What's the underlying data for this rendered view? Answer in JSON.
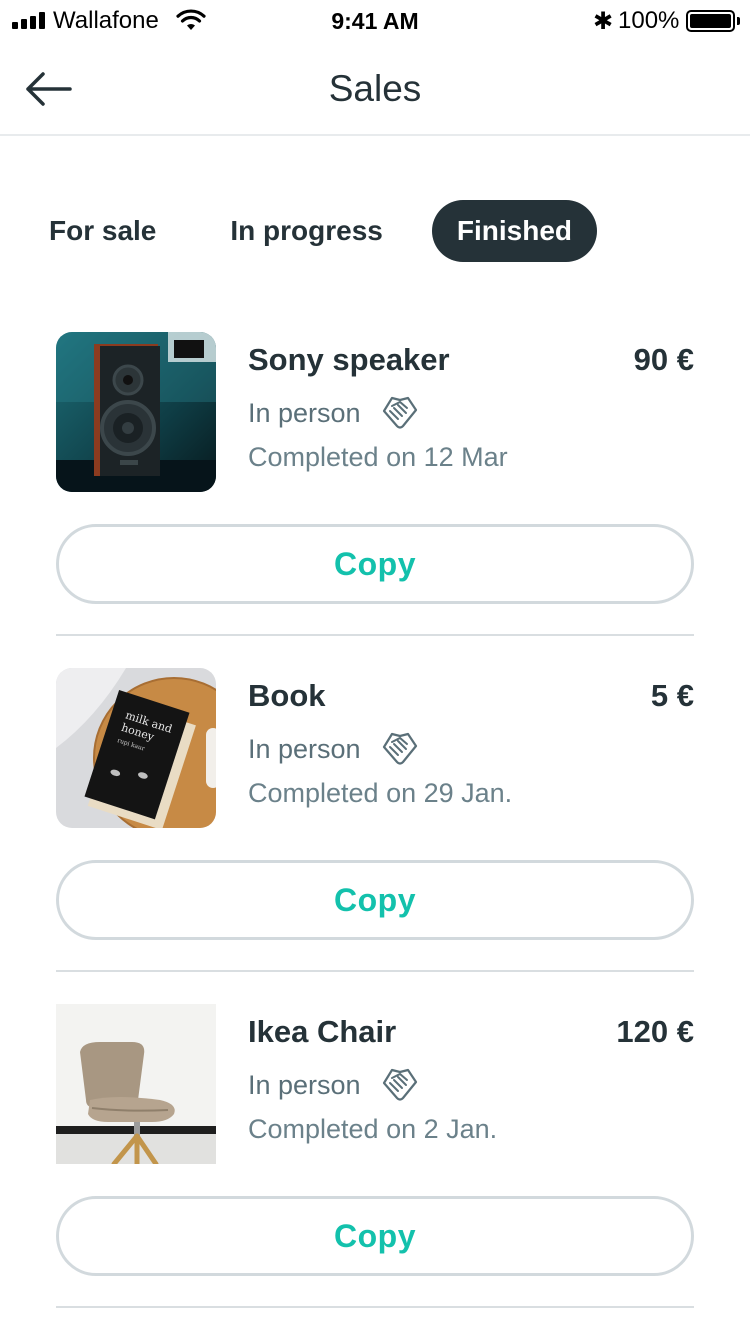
{
  "status_bar": {
    "carrier": "Wallafone",
    "time": "9:41 AM",
    "battery": "100%"
  },
  "header": {
    "title": "Sales",
    "back_icon": "arrow-left-icon"
  },
  "tabs": [
    {
      "label": "For sale",
      "active": false
    },
    {
      "label": "In progress",
      "active": false
    },
    {
      "label": "Finished",
      "active": true
    }
  ],
  "items": [
    {
      "title": "Sony speaker",
      "price": "90 €",
      "delivery": "In person",
      "completed": "Completed on 12 Mar",
      "copy_label": "Copy",
      "image": "speaker"
    },
    {
      "title": "Book",
      "price": "5 €",
      "delivery": "In person",
      "completed": "Completed on 29 Jan.",
      "copy_label": "Copy",
      "image": "book"
    },
    {
      "title": "Ikea Chair",
      "price": "120 €",
      "delivery": "In person",
      "completed": "Completed on 2 Jan.",
      "copy_label": "Copy",
      "image": "chair"
    }
  ],
  "colors": {
    "accent": "#13c1ac",
    "dark": "#253238",
    "muted": "#6b818a"
  }
}
